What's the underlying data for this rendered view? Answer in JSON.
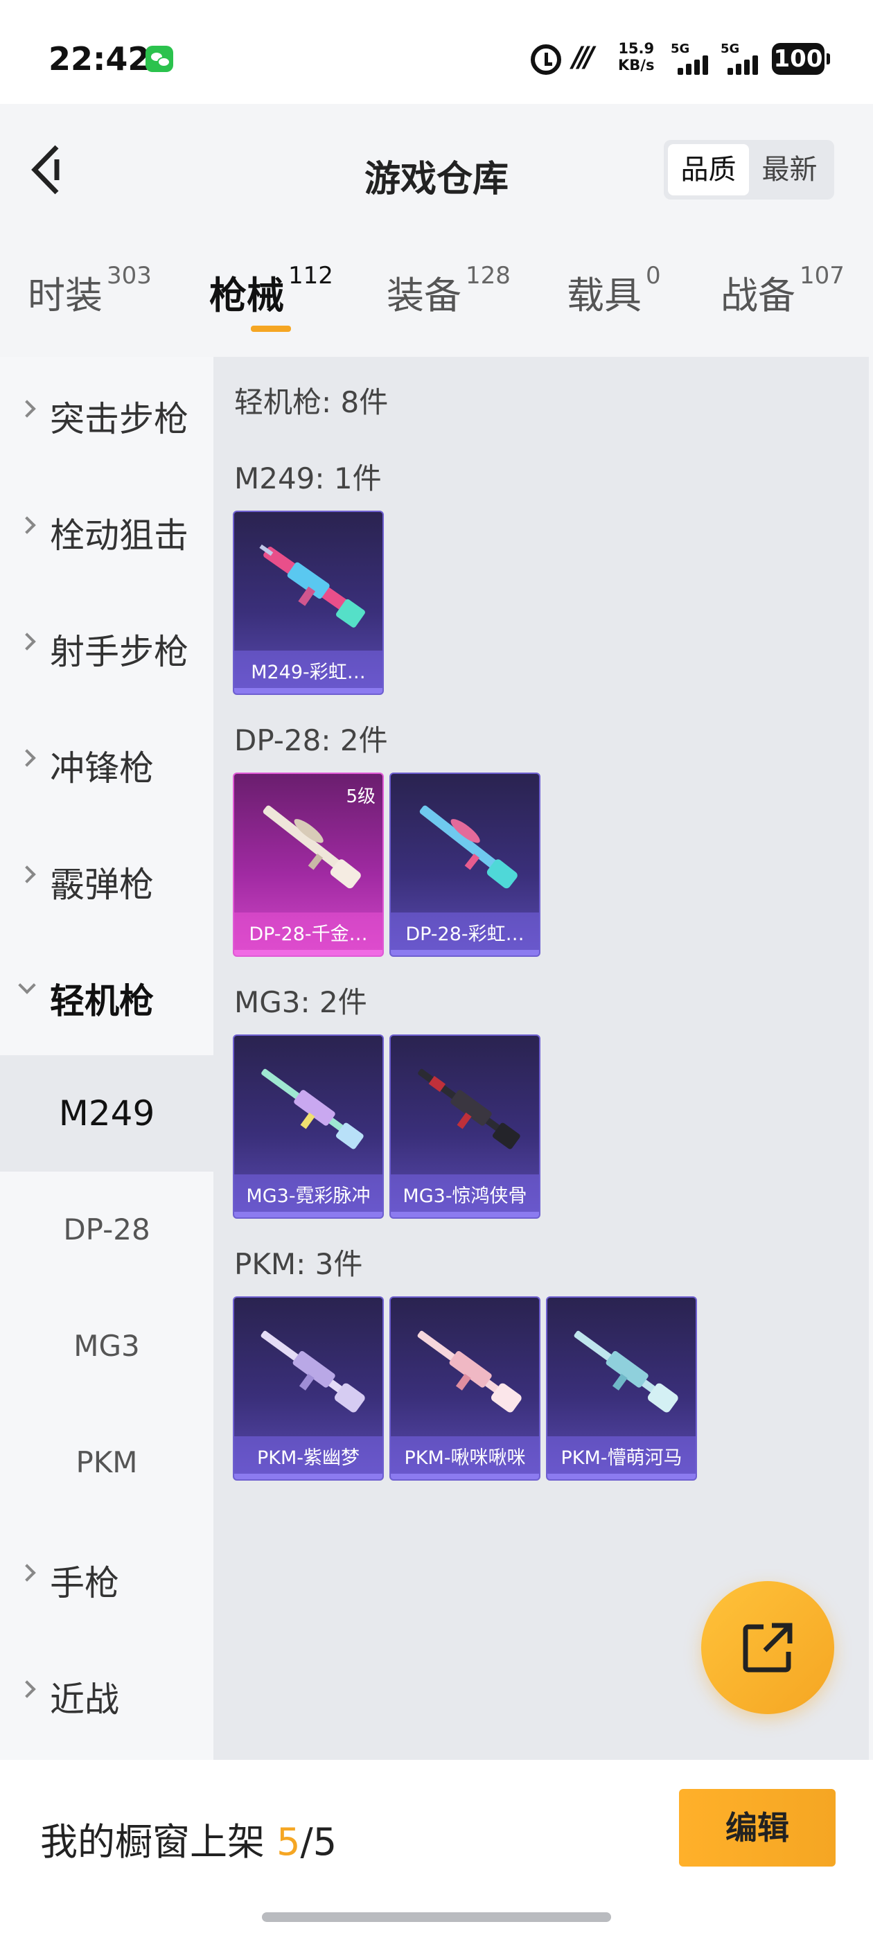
{
  "status_bar": {
    "time": "22:42",
    "speed_value": "15.9",
    "speed_unit": "KB/s",
    "network1": "5G",
    "network2": "5G",
    "battery": "100"
  },
  "header": {
    "title": "游戏仓库",
    "sort_options": [
      {
        "label": "品质",
        "active": true
      },
      {
        "label": "最新",
        "active": false
      }
    ]
  },
  "tabs": [
    {
      "label": "时装",
      "count": "303"
    },
    {
      "label": "枪械",
      "count": "112",
      "active": true
    },
    {
      "label": "装备",
      "count": "128"
    },
    {
      "label": "载具",
      "count": "0"
    },
    {
      "label": "战备",
      "count": "107"
    }
  ],
  "sidebar": {
    "categories": [
      "突击步枪",
      "栓动狙击",
      "射手步枪",
      "冲锋枪",
      "霰弹枪",
      "轻机枪",
      "手枪",
      "近战"
    ],
    "open_category": "轻机枪",
    "subitems": [
      "M249",
      "DP-28",
      "MG3",
      "PKM"
    ],
    "active_subitem": "M249"
  },
  "content": {
    "category_total": "轻机枪: 8件",
    "groups": [
      {
        "title": "M249: 1件",
        "items": [
          {
            "name": "M249-彩虹…",
            "level": ""
          }
        ]
      },
      {
        "title": "DP-28: 2件",
        "items": [
          {
            "name": "DP-28-千金…",
            "level": "5级"
          },
          {
            "name": "DP-28-彩虹…",
            "level": ""
          }
        ]
      },
      {
        "title": "MG3: 2件",
        "items": [
          {
            "name": "MG3-霓彩脉冲",
            "level": ""
          },
          {
            "name": "MG3-惊鸿侠骨",
            "level": ""
          }
        ]
      },
      {
        "title": "PKM: 3件",
        "items": [
          {
            "name": "PKM-紫幽梦",
            "level": ""
          },
          {
            "name": "PKM-啾咪啾咪",
            "level": ""
          },
          {
            "name": "PKM-懵萌河马",
            "level": ""
          }
        ]
      }
    ]
  },
  "bottom_bar": {
    "shelf_label": "我的橱窗上架",
    "shelf_current": "5",
    "shelf_total": "/5",
    "edit_label": "编辑"
  },
  "colors": {
    "accent": "#f5a623",
    "card_purple": "#3a2f7a",
    "card_pink": "#c03bbb"
  },
  "icons": [
    "back-arrow-icon",
    "alarm-icon",
    "nfc-icon",
    "signal-icon",
    "battery-icon",
    "chevron-right-icon",
    "chevron-down-icon",
    "share-external-icon",
    "wechat-icon"
  ]
}
